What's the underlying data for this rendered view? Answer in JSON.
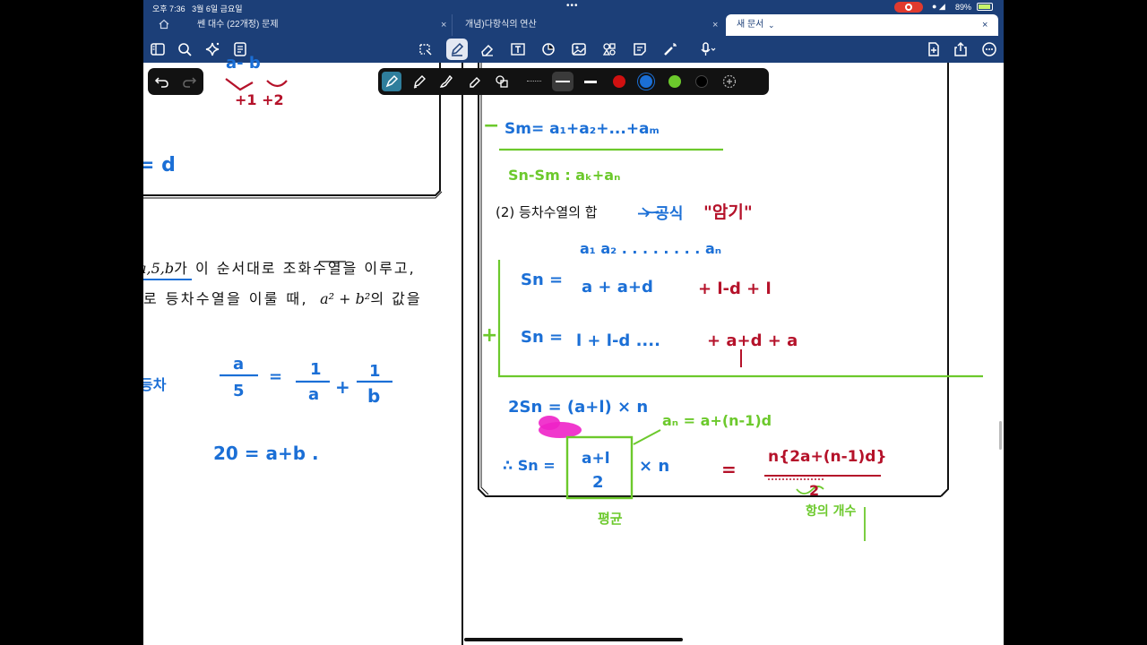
{
  "status": {
    "time": "오후 7:36",
    "date": "3월 6일 금요일",
    "battery": "89%"
  },
  "tabs": [
    {
      "label": "쎈 대수 (22개정) 문제"
    },
    {
      "label": "개념)다항식의 연산"
    },
    {
      "label": "새 문서"
    }
  ],
  "colors": {
    "navy": "#1c3f78",
    "ink_blue": "#1b6fd6",
    "ink_red": "#b5122a",
    "ink_green": "#6cc92c",
    "highlight": "#ee22c8"
  },
  "left_page": {
    "problem_line1_math": "a,5,b",
    "problem_line1_text": "가 이 순서대로 조화수열을 이루고,",
    "problem_line2_text1": "로 등차수열을 이룰 때,",
    "problem_line2_math": "a² + b²",
    "problem_line2_text2": "의 값을",
    "ink": {
      "top_a": "a- b",
      "top_b": "+1  +2",
      "mid": "= d",
      "eq_label": "등차",
      "frac_left_num": "a",
      "frac_left_den": "5",
      "eq_sign": "=",
      "frac_mid_num": "1",
      "frac_mid_den": "a",
      "plus": "+",
      "frac_right_num": "1",
      "frac_right_den": "b",
      "bottom": "20 = a+b ."
    }
  },
  "right_page": {
    "heading": "(2) 등차수열의 합",
    "ink": {
      "minus_sign": "−",
      "top_eq": "Sm= a₁+a₂+...+aₘ",
      "diff": "Sn-Sm : aₖ+aₙ",
      "arrow_note": "→ 공식",
      "quote": "\"암기\"",
      "terms": "a₁   a₂  . . . . . . . .   aₙ",
      "sn1_lhs": "Sn =",
      "sn1_rhs": "a + a+d",
      "sn1_tail": "+ l-d + l",
      "plus_mark": "+",
      "sn2_lhs": "Sn =",
      "sn2_rhs": "l + l-d  ....",
      "sn2_tail": "+ a+d + a",
      "two_sn": "2Sn = (a+l) × n",
      "an_note": "aₙ = a+(n-1)d",
      "therefore": "∴ Sn =",
      "box_num": "a+l",
      "box_den": "2",
      "times_n": "× n",
      "equals": "=",
      "final_num": "n{2a+(n-1)d}",
      "final_den": "2",
      "label_left": "평균",
      "label_right": "항의 개수"
    }
  }
}
